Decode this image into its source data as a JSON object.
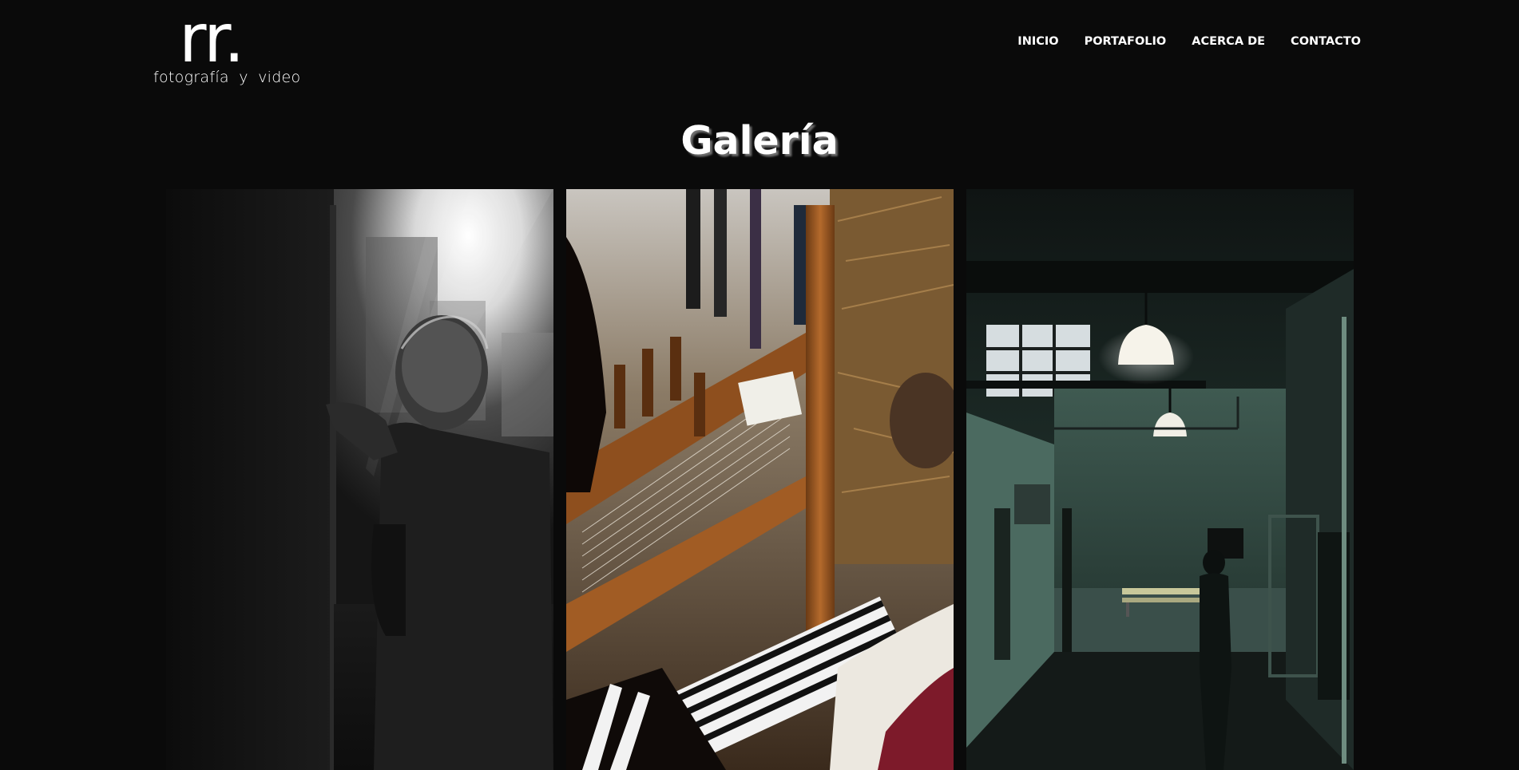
{
  "brand": {
    "mark": "rr.",
    "tagline": "fotografía y video"
  },
  "nav": {
    "items": [
      {
        "label": "INICIO"
      },
      {
        "label": "PORTAFOLIO"
      },
      {
        "label": "ACERCA DE"
      },
      {
        "label": "CONTACTO"
      }
    ]
  },
  "page": {
    "title": "Galería"
  },
  "gallery": {
    "photos": [
      {
        "subject": "backlit-portrait-bw"
      },
      {
        "subject": "weaving-loom"
      },
      {
        "subject": "green-hallway"
      }
    ]
  },
  "colors": {
    "background": "#0a0a0a",
    "text": "#ffffff",
    "title_shadow": "#6e6e6e"
  }
}
